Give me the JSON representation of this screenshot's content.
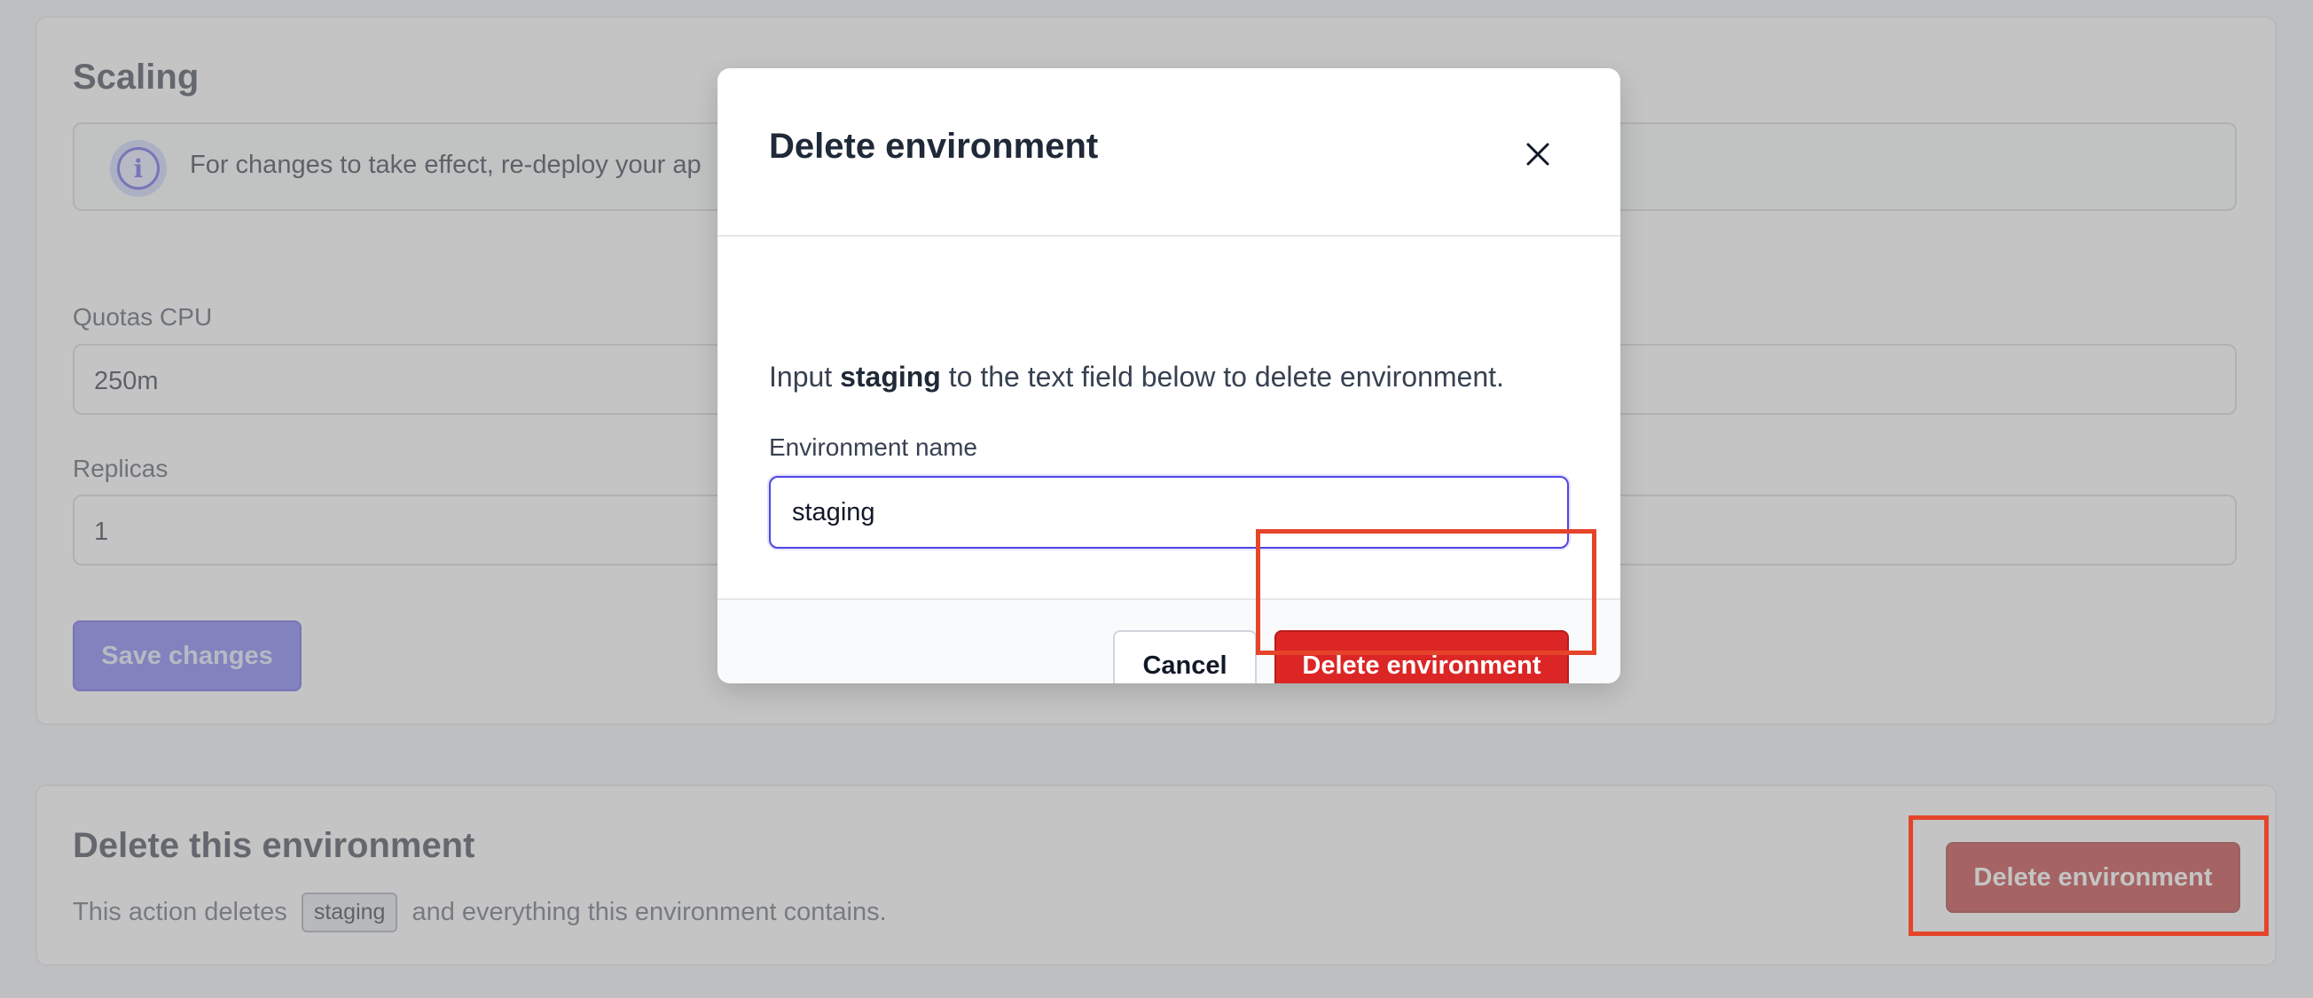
{
  "scaling": {
    "title": "Scaling",
    "info": {
      "icon": "info-icon",
      "text": "For changes to take effect, re-deploy your ap"
    },
    "cpu": {
      "label": "Quotas CPU",
      "value": "250m"
    },
    "replicas": {
      "label": "Replicas",
      "value": "1"
    },
    "save_label": "Save changes"
  },
  "danger": {
    "title": "Delete this environment",
    "desc_prefix": "This action deletes",
    "env_name": "staging",
    "desc_suffix": "and everything this environment contains.",
    "button_label": "Delete environment"
  },
  "modal": {
    "title": "Delete environment",
    "close_icon": "close-icon",
    "instruction_prefix": "Input",
    "instruction_env": "staging",
    "instruction_suffix": "to the text field below to delete environment.",
    "field_label": "Environment name",
    "field_value": "staging",
    "cancel_label": "Cancel",
    "confirm_label": "Delete environment"
  },
  "colors": {
    "accent": "#4f46e5",
    "danger": "#dc2626",
    "highlight": "#e5442b"
  }
}
